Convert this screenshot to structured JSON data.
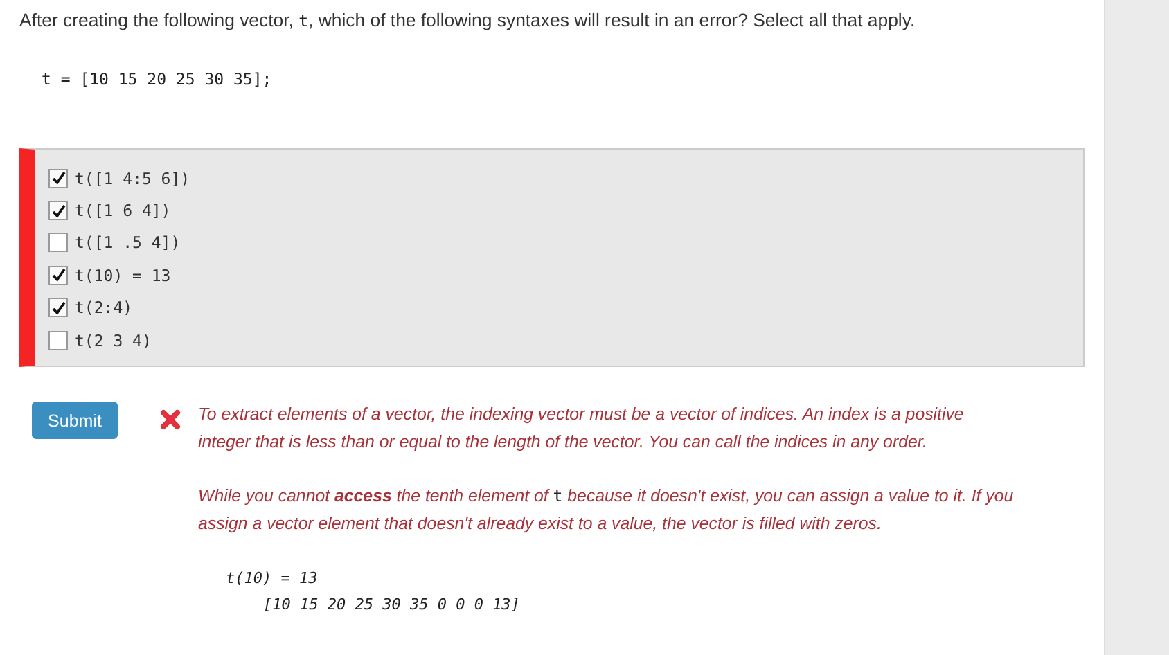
{
  "question": {
    "segments": [
      {
        "kind": "text",
        "text": "After creating the following vector, "
      },
      {
        "kind": "code",
        "text": "t"
      },
      {
        "kind": "text",
        "text": ", which of the following syntaxes will result in an error?  Select all that apply."
      }
    ]
  },
  "setup_code": "t = [10 15 20 25 30 35];",
  "answer_correct": false,
  "options": [
    {
      "label": "t([1 4:5 6])",
      "checked": true
    },
    {
      "label": "t([1 6 4])",
      "checked": true
    },
    {
      "label": "t([1 .5 4])",
      "checked": false
    },
    {
      "label": "t(10) = 13",
      "checked": true
    },
    {
      "label": "t(2:4)",
      "checked": true
    },
    {
      "label": "t(2 3 4)",
      "checked": false
    }
  ],
  "submit_label": "Submit",
  "feedback": {
    "paragraphs": [
      {
        "segments": [
          {
            "kind": "text",
            "text": "To extract elements of a vector, the indexing vector must be a vector of indices.  An index is a positive integer that is less than or equal to the length of the vector. You can call the indices in any order."
          }
        ]
      },
      {
        "segments": [
          {
            "kind": "text",
            "text": "While you cannot **access** the tenth element of "
          },
          {
            "kind": "code",
            "text": "t"
          },
          {
            "kind": "text",
            "text": " because it doesn't exist, you can assign a value to it. If you assign a vector element that doesn't already exist to a value, the vector is filled with zeros."
          }
        ]
      }
    ],
    "code_lines": [
      {
        "kind": "command",
        "text": "t(10) = 13"
      },
      {
        "kind": "output",
        "text": "[10 15 20 25 30 35 0 0 0 13]"
      }
    ]
  }
}
